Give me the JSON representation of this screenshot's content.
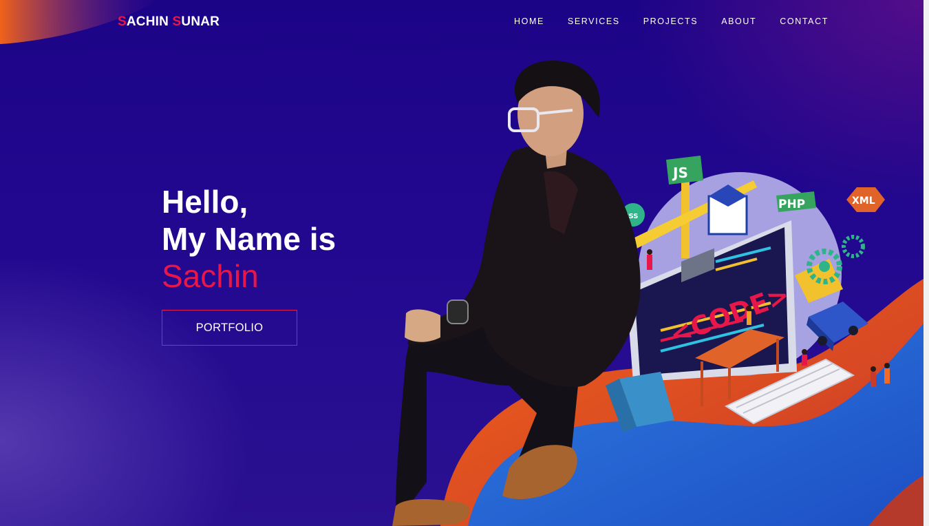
{
  "brand": {
    "initial_1": "S",
    "part_1": "ACHIN ",
    "initial_2": "S",
    "part_2": "UNAR"
  },
  "nav": {
    "items": [
      "HOME",
      "SERVICES",
      "PROJECTS",
      "ABOUT",
      "CONTACT"
    ]
  },
  "hero": {
    "line_1": "Hello,",
    "line_2": "My Name is",
    "name": "Sachin",
    "cta_label": "PORTFOLIO"
  },
  "illustration": {
    "code_label": "<CODE>",
    "tags": [
      "JS",
      "PHP",
      "XML",
      "CSS"
    ]
  },
  "colors": {
    "accent": "#e8174a",
    "background": "#1c0487",
    "wave_orange": "#e8531c",
    "wave_blue": "#2a6fd6"
  }
}
